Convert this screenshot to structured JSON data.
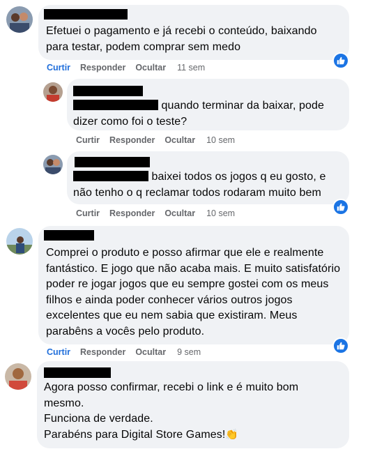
{
  "comments": [
    {
      "text": "Efetuei o pagamento e já recebi o conteúdo, baixando para testar, podem comprar sem medo",
      "actions": {
        "like": "Curtir",
        "reply": "Responder",
        "hide": "Ocultar",
        "time": "11 sem"
      },
      "replies": [
        {
          "text": "quando terminar da baixar, pode dizer como foi o teste?",
          "actions": {
            "like": "Curtir",
            "reply": "Responder",
            "hide": "Ocultar",
            "time": "10 sem"
          }
        },
        {
          "text_line1": "baixei todos os jogos q eu gosto, e",
          "text_line2": "não tenho o q reclamar todos rodaram muito bem",
          "actions": {
            "like": "Curtir",
            "reply": "Responder",
            "hide": "Ocultar",
            "time": "10 sem"
          }
        }
      ]
    },
    {
      "text": "Comprei o produto e posso afirmar que ele e realmente fantástico. E jogo que não acaba mais. E muito satisfatório poder re jogar jogos que eu sempre gostei com os meus filhos e ainda poder conhecer vários outros jogos excelentes que eu nem sabia que existiram. Meus parabêns a vocês pelo produto.",
      "actions": {
        "like": "Curtir",
        "reply": "Responder",
        "hide": "Ocultar",
        "time": "9 sem"
      }
    },
    {
      "lines": [
        "Agora posso confirmar, recebi o link e é muito bom",
        "mesmo.",
        "Funciona de verdade.",
        "Parabéns para Digital Store Games!"
      ],
      "emoji": "👏"
    }
  ],
  "colors": {
    "bubble": "#f0f2f5",
    "like_blue": "#216fdb",
    "meta_gray": "#65676b",
    "badge": "#1b74e4"
  },
  "icons": {
    "like_badge": "thumbs-up-icon"
  }
}
